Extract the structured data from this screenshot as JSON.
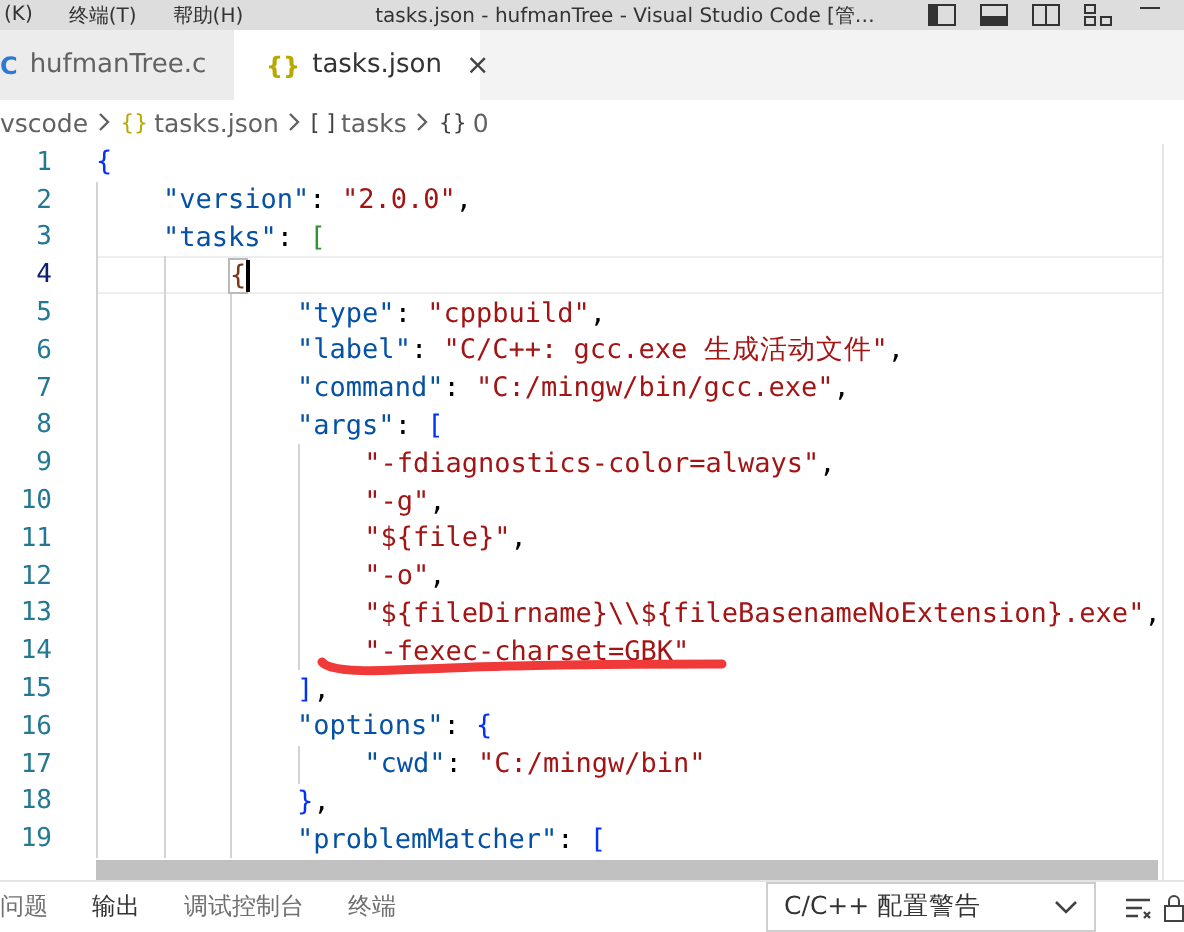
{
  "title_bar": {
    "menus": [
      "(K)",
      "终端(T)",
      "帮助(H)"
    ],
    "title": "tasks.json - hufmanTree - Visual Studio Code [管…"
  },
  "tabs": [
    {
      "label": "hufmanTree.c",
      "kind": "c",
      "icon": "C",
      "selected": false
    },
    {
      "label": "tasks.json",
      "kind": "json",
      "icon": "{}",
      "close": "×",
      "selected": true
    }
  ],
  "breadcrumbs": [
    {
      "label": "vscode",
      "kind": "folder"
    },
    {
      "label": "tasks.json",
      "kind": "json",
      "icon": "{}"
    },
    {
      "label": "tasks",
      "kind": "array",
      "icon": "[ ]"
    },
    {
      "label": "0",
      "kind": "object",
      "icon": "{}"
    }
  ],
  "lines": [
    {
      "number": "1",
      "current": false,
      "underlined": false,
      "tokens": [
        {
          "kind": "bracket",
          "text": "{",
          "color": "#0431fa"
        }
      ]
    },
    {
      "number": "2",
      "current": false,
      "underlined": false,
      "tokens": [
        {
          "kind": "key",
          "text": "    \"version\""
        },
        {
          "kind": "punct",
          "text": ":"
        },
        {
          "kind": "string",
          "text": " \"2.0.0\""
        },
        {
          "kind": "punct",
          "text": ","
        }
      ]
    },
    {
      "number": "3",
      "current": false,
      "underlined": false,
      "tokens": [
        {
          "kind": "key",
          "text": "    \"tasks\""
        },
        {
          "kind": "punct",
          "text": ":"
        },
        {
          "kind": "bracket",
          "text": " [",
          "color": "#319331"
        }
      ]
    },
    {
      "number": "4",
      "current": true,
      "underlined": false,
      "tokens": [
        {
          "kind": "bracket",
          "text": "        {",
          "color": "#7b3814",
          "matched": true
        }
      ]
    },
    {
      "number": "5",
      "current": false,
      "underlined": false,
      "tokens": [
        {
          "kind": "key",
          "text": "            \"type\""
        },
        {
          "kind": "punct",
          "text": ":"
        },
        {
          "kind": "string",
          "text": " \"cppbuild\""
        },
        {
          "kind": "punct",
          "text": ","
        }
      ]
    },
    {
      "number": "6",
      "current": false,
      "underlined": false,
      "tokens": [
        {
          "kind": "key",
          "text": "            \"label\""
        },
        {
          "kind": "punct",
          "text": ":"
        },
        {
          "kind": "string",
          "text": " \"C/C++: gcc.exe 生成活动文件\""
        },
        {
          "kind": "punct",
          "text": ","
        }
      ]
    },
    {
      "number": "7",
      "current": false,
      "underlined": false,
      "tokens": [
        {
          "kind": "key",
          "text": "            \"command\""
        },
        {
          "kind": "punct",
          "text": ":"
        },
        {
          "kind": "string",
          "text": " \"C:/mingw/bin/gcc.exe\""
        },
        {
          "kind": "punct",
          "text": ","
        }
      ]
    },
    {
      "number": "8",
      "current": false,
      "underlined": false,
      "tokens": [
        {
          "kind": "key",
          "text": "            \"args\""
        },
        {
          "kind": "punct",
          "text": ":"
        },
        {
          "kind": "bracket",
          "text": " [",
          "color": "#0431fa"
        }
      ]
    },
    {
      "number": "9",
      "current": false,
      "underlined": false,
      "tokens": [
        {
          "kind": "string",
          "text": "                \"-fdiagnostics-color=always\""
        },
        {
          "kind": "punct",
          "text": ","
        }
      ]
    },
    {
      "number": "10",
      "current": false,
      "underlined": false,
      "tokens": [
        {
          "kind": "string",
          "text": "                \"-g\""
        },
        {
          "kind": "punct",
          "text": ","
        }
      ]
    },
    {
      "number": "11",
      "current": false,
      "underlined": false,
      "tokens": [
        {
          "kind": "string",
          "text": "                \"${file}\""
        },
        {
          "kind": "punct",
          "text": ","
        }
      ]
    },
    {
      "number": "12",
      "current": false,
      "underlined": false,
      "tokens": [
        {
          "kind": "string",
          "text": "                \"-o\""
        },
        {
          "kind": "punct",
          "text": ","
        }
      ]
    },
    {
      "number": "13",
      "current": false,
      "underlined": false,
      "tokens": [
        {
          "kind": "string",
          "text": "                \"${fileDirname}\\\\${fileBasenameNoExtension}.exe\""
        },
        {
          "kind": "punct",
          "text": ","
        }
      ]
    },
    {
      "number": "14",
      "current": false,
      "underlined": true,
      "tokens": [
        {
          "kind": "string",
          "text": "                \"-fexec-charset=GBK\""
        }
      ]
    },
    {
      "number": "15",
      "current": false,
      "underlined": false,
      "tokens": [
        {
          "kind": "bracket",
          "text": "            ]",
          "color": "#0431fa"
        },
        {
          "kind": "punct",
          "text": ","
        }
      ]
    },
    {
      "number": "16",
      "current": false,
      "underlined": false,
      "tokens": [
        {
          "kind": "key",
          "text": "            \"options\""
        },
        {
          "kind": "punct",
          "text": ":"
        },
        {
          "kind": "bracket",
          "text": " {",
          "color": "#0431fa"
        }
      ]
    },
    {
      "number": "17",
      "current": false,
      "underlined": false,
      "tokens": [
        {
          "kind": "key",
          "text": "                \"cwd\""
        },
        {
          "kind": "punct",
          "text": ":"
        },
        {
          "kind": "string",
          "text": " \"C:/mingw/bin\""
        }
      ]
    },
    {
      "number": "18",
      "current": false,
      "underlined": false,
      "tokens": [
        {
          "kind": "bracket",
          "text": "            }",
          "color": "#0431fa"
        },
        {
          "kind": "punct",
          "text": ","
        }
      ]
    },
    {
      "number": "19",
      "current": false,
      "underlined": false,
      "tokens": [
        {
          "kind": "key",
          "text": "            \"problemMatcher\""
        },
        {
          "kind": "punct",
          "text": ":"
        },
        {
          "kind": "bracket",
          "text": " [",
          "color": "#0431fa"
        }
      ]
    }
  ],
  "panel": {
    "tabs": [
      {
        "label": "问题",
        "selected": false
      },
      {
        "label": "输出",
        "selected": true
      },
      {
        "label": "调试控制台",
        "selected": false
      },
      {
        "label": "终端",
        "selected": false
      }
    ],
    "dropdown": {
      "value": "C/C++ 配置警告"
    }
  }
}
